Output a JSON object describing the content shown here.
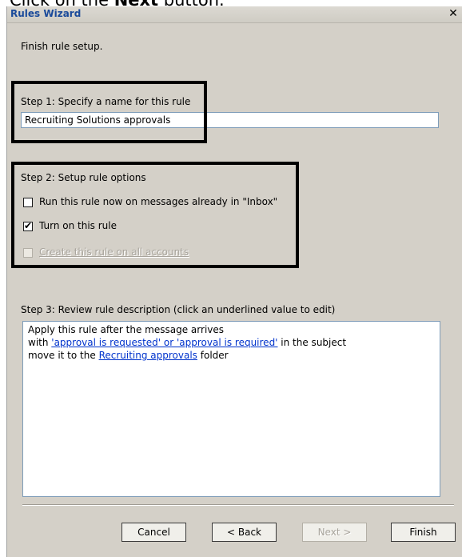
{
  "caption": {
    "prefix": "Click on the ",
    "bold": "Next",
    "suffix": " button."
  },
  "window": {
    "title": "Rules Wizard",
    "close_glyph": "✕"
  },
  "intro_text": "Finish rule setup.",
  "step1": {
    "label": "Step 1: Specify a name for this rule",
    "rule_name": "Recruiting Solutions approvals"
  },
  "step2": {
    "label": "Step 2: Setup rule options",
    "options": [
      {
        "label": "Run this rule now on messages already in \"Inbox\"",
        "checked": false,
        "enabled": true
      },
      {
        "label": "Turn on this rule",
        "checked": true,
        "enabled": true
      },
      {
        "label": "Create this rule on all accounts",
        "checked": false,
        "enabled": false
      }
    ]
  },
  "step3": {
    "label": "Step 3: Review rule description (click an underlined value to edit)",
    "line1": "Apply this rule after the message arrives",
    "line2_prefix": "with ",
    "line2_link": "'approval is requested' or 'approval is required'",
    "line2_suffix": " in the subject",
    "line3_prefix": "move it to the ",
    "line3_link": "Recruiting approvals",
    "line3_suffix": " folder"
  },
  "buttons": {
    "cancel": "Cancel",
    "back": "< Back",
    "next": "Next >",
    "finish": "Finish"
  },
  "icons": {
    "checkmark": "check-icon",
    "close": "close-icon"
  }
}
